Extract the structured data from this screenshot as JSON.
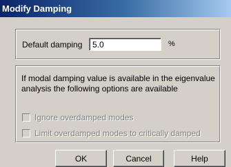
{
  "window": {
    "title": "Modify Damping"
  },
  "damping": {
    "label": "Default damping",
    "value": "5.0",
    "unit": "%"
  },
  "modal": {
    "info": "If modal damping value is available in the eigenvalue analysis the following options are available",
    "options": [
      {
        "label": "Ignore overdamped modes",
        "checked": false,
        "enabled": false
      },
      {
        "label": "Limit overdamped modes to critically damped",
        "checked": false,
        "enabled": false
      }
    ]
  },
  "buttons": {
    "ok": "OK",
    "cancel": "Cancel",
    "help": "Help"
  },
  "colors": {
    "dialog_face": "#d4d0c8",
    "titlebar_start": "#0a246a",
    "titlebar_end": "#a6caf0",
    "disabled_text": "#808080"
  }
}
